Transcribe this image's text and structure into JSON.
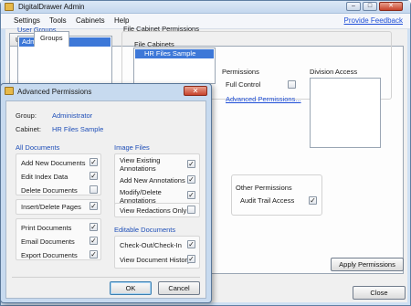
{
  "main": {
    "title": "DigitalDrawer Admin",
    "menu": [
      "Settings",
      "Tools",
      "Cabinets",
      "Help"
    ],
    "feedback_link": "Provide Feedback",
    "tabs": [
      "Users",
      "Groups"
    ],
    "active_tab": "Groups",
    "user_groups_label": "User Groups",
    "user_groups_selected": "Administrator",
    "file_cabinet_permissions_label": "File Cabinet Permissions",
    "file_cabinets_header": "File Cabinets",
    "file_cabinet_selected": "HR Files Sample",
    "permissions_header": "Permissions",
    "full_control_label": "Full Control",
    "full_control_checked": false,
    "advanced_permissions_link": "Advanced Permissions...",
    "division_access_header": "Division Access",
    "other_permissions_label": "Other Permissions",
    "audit_trail_label": "Audit Trail Access",
    "audit_trail_checked": true,
    "apply_button": "Apply Permissions",
    "close_button": "Close"
  },
  "dialog": {
    "title": "Advanced Permissions",
    "group_label": "Group:",
    "group_value": "Administrator",
    "cabinet_label": "Cabinet:",
    "cabinet_value": "HR Files Sample",
    "all_documents_header": "All Documents",
    "all_documents": [
      {
        "label": "Add New Documents",
        "checked": true
      },
      {
        "label": "Edit Index Data",
        "checked": true
      },
      {
        "label": "Delete Documents",
        "checked": false
      },
      {
        "label": "Insert/Delete Pages",
        "checked": true
      },
      {
        "label": "Print Documents",
        "checked": true
      },
      {
        "label": "Email Documents",
        "checked": true
      },
      {
        "label": "Export Documents",
        "checked": true
      }
    ],
    "image_files_header": "Image Files",
    "image_files": [
      {
        "label": "View Existing Annotations",
        "checked": true
      },
      {
        "label": "Add New Annotations",
        "checked": true
      },
      {
        "label": "Modify/Delete Annotations",
        "checked": true
      },
      {
        "label": "View Redactions Only",
        "checked": false
      }
    ],
    "editable_documents_header": "Editable Documents",
    "editable_documents": [
      {
        "label": "Check-Out/Check-In",
        "checked": true
      },
      {
        "label": "View Document History",
        "checked": true
      }
    ],
    "ok_button": "OK",
    "cancel_button": "Cancel"
  }
}
